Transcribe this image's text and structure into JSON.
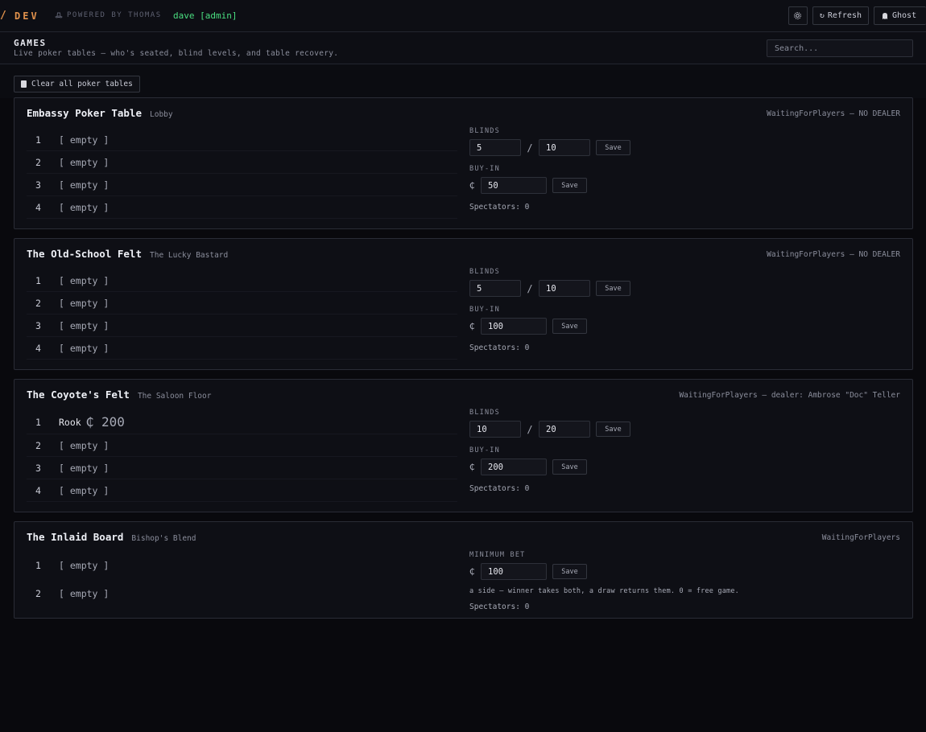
{
  "topbar": {
    "brand": "DEV",
    "powered_by": "POWERED BY THOMAS",
    "user": "dave [admin]",
    "refresh_label": "Refresh",
    "ghost_label": "Ghost"
  },
  "header": {
    "title": "GAMES",
    "subtitle": "Live poker tables — who's seated, blind levels, and table recovery.",
    "search_placeholder": "Search..."
  },
  "toolbar": {
    "clear_label": "Clear all poker tables"
  },
  "labels": {
    "blinds": "BLINDS",
    "buyin": "BUY-IN",
    "minbet": "MINIMUM BET",
    "save": "Save",
    "currency": "₵",
    "slash": "/",
    "empty": "[ empty ]"
  },
  "tables": [
    {
      "name": "Embassy Poker Table",
      "room": "Lobby",
      "status": "WaitingForPlayers — NO DEALER",
      "seats": [
        {
          "num": "1",
          "occupant": "[ empty ]"
        },
        {
          "num": "2",
          "occupant": "[ empty ]"
        },
        {
          "num": "3",
          "occupant": "[ empty ]"
        },
        {
          "num": "4",
          "occupant": "[ empty ]"
        }
      ],
      "small_blind": "5",
      "big_blind": "10",
      "buyin": "50",
      "spectators": "Spectators: 0"
    },
    {
      "name": "The Old-School Felt",
      "room": "The Lucky Bastard",
      "status": "WaitingForPlayers — NO DEALER",
      "seats": [
        {
          "num": "1",
          "occupant": "[ empty ]"
        },
        {
          "num": "2",
          "occupant": "[ empty ]"
        },
        {
          "num": "3",
          "occupant": "[ empty ]"
        },
        {
          "num": "4",
          "occupant": "[ empty ]"
        }
      ],
      "small_blind": "5",
      "big_blind": "10",
      "buyin": "100",
      "spectators": "Spectators: 0"
    },
    {
      "name": "The Coyote's Felt",
      "room": "The Saloon Floor",
      "status": "WaitingForPlayers — dealer: Ambrose \"Doc\" Teller",
      "seats": [
        {
          "num": "1",
          "occupant": "Rook",
          "chips": "₵ 200"
        },
        {
          "num": "2",
          "occupant": "[ empty ]"
        },
        {
          "num": "3",
          "occupant": "[ empty ]"
        },
        {
          "num": "4",
          "occupant": "[ empty ]"
        }
      ],
      "small_blind": "10",
      "big_blind": "20",
      "buyin": "200",
      "spectators": "Spectators: 0"
    },
    {
      "name": "The Inlaid Board",
      "room": "Bishop's Blend",
      "status": "WaitingForPlayers",
      "seats": [
        {
          "num": "1",
          "occupant": "[ empty ]"
        },
        {
          "num": "2",
          "occupant": "[ empty ]"
        }
      ],
      "min_bet": "100",
      "note": "a side — winner takes both, a draw returns them. 0 = free game.",
      "spectators": "Spectators: 0"
    }
  ]
}
